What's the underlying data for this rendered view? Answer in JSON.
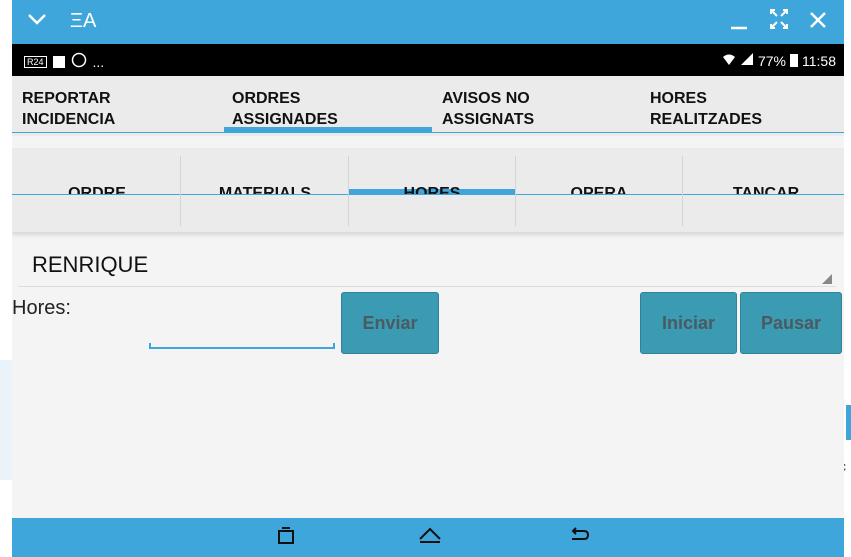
{
  "window": {
    "title": "ΞA",
    "controls": [
      "_",
      "⤢",
      "✕"
    ]
  },
  "statusbar": {
    "left_text": "...",
    "battery": "77%",
    "time": "11:58"
  },
  "primary_tabs": [
    {
      "line1": "REPORTAR",
      "line2": "INCIDENCIA",
      "active": false
    },
    {
      "line1": "ORDRES",
      "line2": "ASSIGNADES",
      "active": true
    },
    {
      "line1": "AVISOS NO",
      "line2": "ASSIGNATS",
      "active": false
    },
    {
      "line1": "HORES",
      "line2": "REALITZADES",
      "active": false
    }
  ],
  "secondary_tabs": [
    {
      "label": "ORDRE",
      "active": false
    },
    {
      "label": "MATERIALS",
      "active": false
    },
    {
      "label": "HORES",
      "active": true
    },
    {
      "label": "OPERA",
      "active": false
    },
    {
      "label": "TANCAR",
      "active": false
    }
  ],
  "form": {
    "user_select_value": "RENRIQUE",
    "hores_label": "Hores:",
    "hores_value": "",
    "enviar_label": "Enviar",
    "iniciar_label": "Iniciar",
    "pausar_label": "Pausar"
  },
  "navbar": {
    "icons": [
      "recents-icon",
      "home-icon",
      "back-icon"
    ]
  },
  "colors": {
    "accent": "#3fa6dc",
    "button": "#3b9bb3",
    "button_text": "#4a5a62"
  }
}
